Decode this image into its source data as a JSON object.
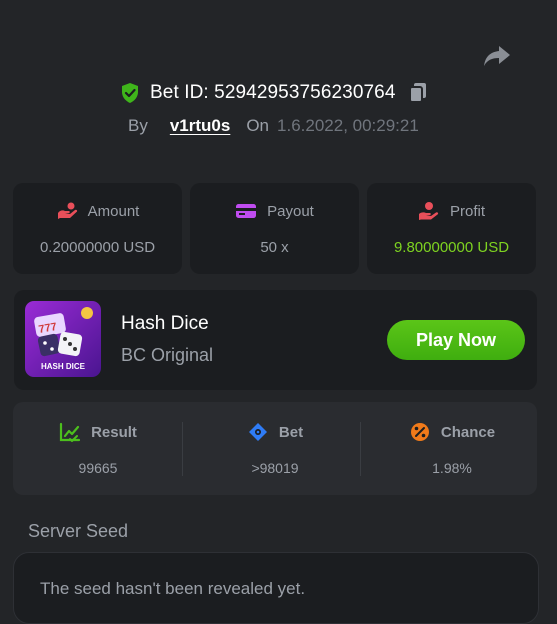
{
  "header": {
    "bet_id": "Bet ID: 52942953756230764",
    "by_label": "By",
    "username": "v1rtu0s",
    "on_label": "On",
    "date": "1.6.2022, 00:29:21"
  },
  "stats": {
    "amount": {
      "label": "Amount",
      "value": "0.20000000 USD",
      "icon": "wallet-hand-icon"
    },
    "payout": {
      "label": "Payout",
      "value": "50 x",
      "icon": "card-icon"
    },
    "profit": {
      "label": "Profit",
      "value": "9.80000000 USD",
      "icon": "hand-coin-icon",
      "color": "#7ed321"
    }
  },
  "game": {
    "name": "Hash Dice",
    "subtitle": "BC Original",
    "thumb_text": "HASH DICE",
    "play_label": "Play Now"
  },
  "result": {
    "result": {
      "label": "Result",
      "value": "99665",
      "icon": "chart-check-icon",
      "color": "#4cbf1d"
    },
    "bet": {
      "label": "Bet",
      "value": ">98019",
      "icon": "diamond-target-icon",
      "color": "#2f7cf6"
    },
    "chance": {
      "label": "Chance",
      "value": "1.98%",
      "icon": "percent-icon",
      "color": "#f07a1a"
    }
  },
  "seed": {
    "label": "Server Seed",
    "text": "The seed hasn't been revealed yet."
  },
  "colors": {
    "background": "#232528",
    "card": "#1b1d20",
    "accent_green": "#4cbf1d",
    "accent_red": "#e94f5a"
  }
}
